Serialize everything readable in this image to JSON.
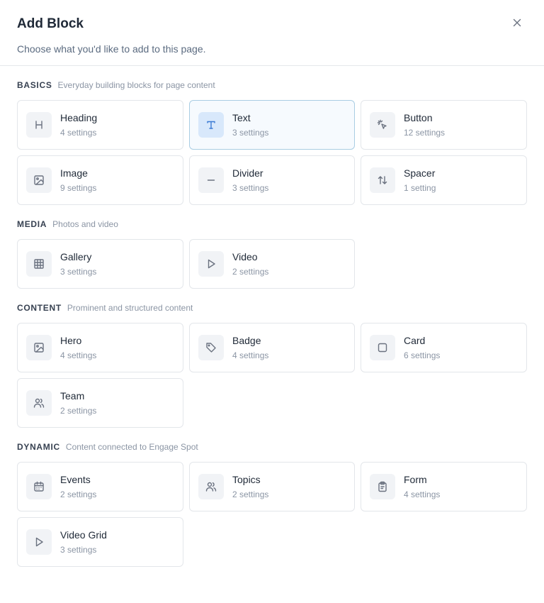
{
  "modal": {
    "title": "Add Block",
    "subtitle": "Choose what you'd like to add to this page."
  },
  "colors": {
    "selected_border": "#a9cde3",
    "selected_icon_bg": "#d8e8fb",
    "selected_icon": "#3b7bd4"
  },
  "sections": [
    {
      "name": "BASICS",
      "description": "Everyday building blocks for page content",
      "blocks": [
        {
          "label": "Heading",
          "meta": "4 settings",
          "icon": "heading-icon",
          "selected": false
        },
        {
          "label": "Text",
          "meta": "3 settings",
          "icon": "text-icon",
          "selected": true
        },
        {
          "label": "Button",
          "meta": "12 settings",
          "icon": "pointer-click-icon",
          "selected": false
        },
        {
          "label": "Image",
          "meta": "9 settings",
          "icon": "image-icon",
          "selected": false
        },
        {
          "label": "Divider",
          "meta": "3 settings",
          "icon": "minus-icon",
          "selected": false
        },
        {
          "label": "Spacer",
          "meta": "1 setting",
          "icon": "arrows-up-down-icon",
          "selected": false
        }
      ]
    },
    {
      "name": "MEDIA",
      "description": "Photos and video",
      "blocks": [
        {
          "label": "Gallery",
          "meta": "3 settings",
          "icon": "grid-icon",
          "selected": false
        },
        {
          "label": "Video",
          "meta": "2 settings",
          "icon": "play-icon",
          "selected": false
        }
      ]
    },
    {
      "name": "CONTENT",
      "description": "Prominent and structured content",
      "blocks": [
        {
          "label": "Hero",
          "meta": "4 settings",
          "icon": "image-icon",
          "selected": false
        },
        {
          "label": "Badge",
          "meta": "4 settings",
          "icon": "tag-icon",
          "selected": false
        },
        {
          "label": "Card",
          "meta": "6 settings",
          "icon": "square-icon",
          "selected": false
        },
        {
          "label": "Team",
          "meta": "2 settings",
          "icon": "users-icon",
          "selected": false
        }
      ]
    },
    {
      "name": "DYNAMIC",
      "description": "Content connected to Engage Spot",
      "blocks": [
        {
          "label": "Events",
          "meta": "2 settings",
          "icon": "calendar-icon",
          "selected": false
        },
        {
          "label": "Topics",
          "meta": "2 settings",
          "icon": "users-icon",
          "selected": false
        },
        {
          "label": "Form",
          "meta": "4 settings",
          "icon": "clipboard-icon",
          "selected": false
        },
        {
          "label": "Video Grid",
          "meta": "3 settings",
          "icon": "play-icon",
          "selected": false
        }
      ]
    }
  ]
}
